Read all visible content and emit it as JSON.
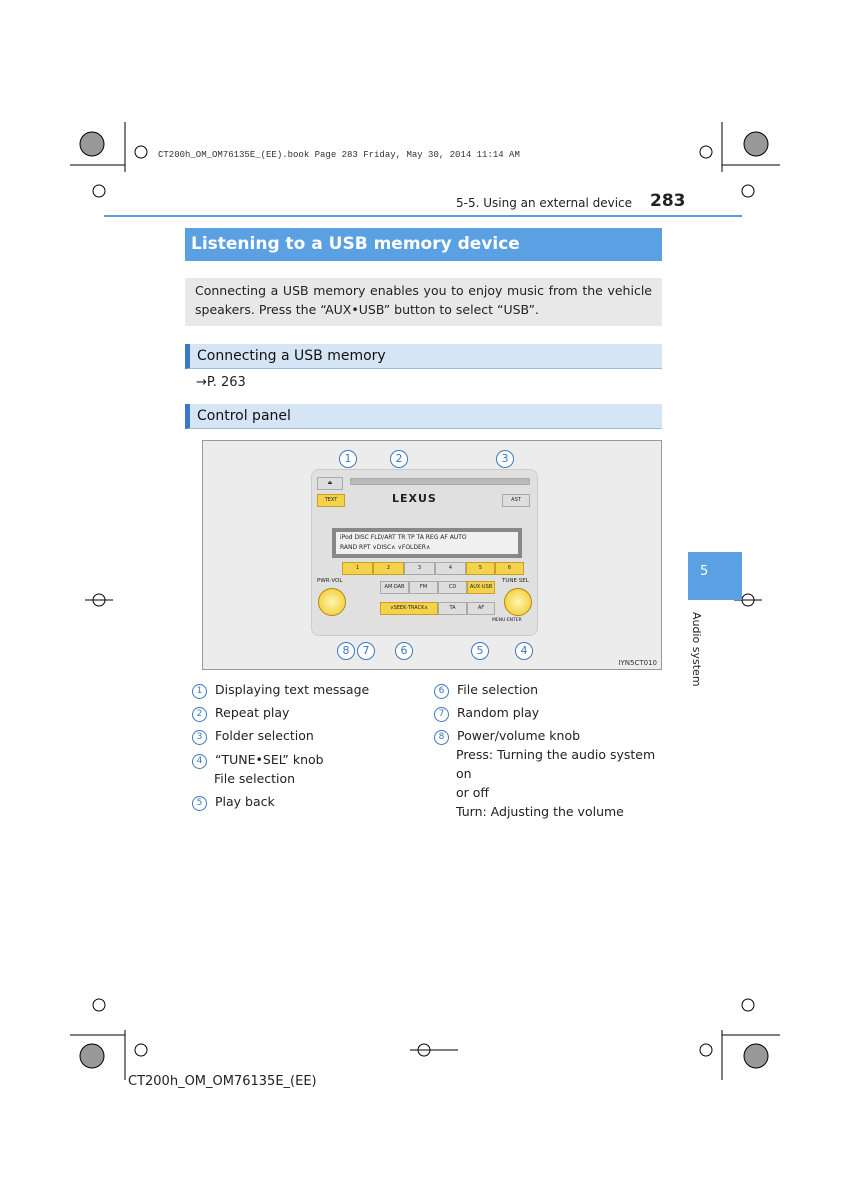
{
  "header": {
    "bookline": "CT200h_OM_OM76135E_(EE).book  Page 283  Friday, May 30, 2014  11:14 AM",
    "section": "5-5. Using an external device",
    "page_number": "283"
  },
  "title": "Listening to a USB memory device",
  "intro": "Connecting a USB memory enables you to enjoy music from the vehicle speakers. Press the “AUX•USB” button to select “USB”.",
  "sections": [
    {
      "title": "Connecting a USB memory",
      "ref": "→P. 263"
    },
    {
      "title": "Control panel"
    }
  ],
  "diagram": {
    "code": "IYN5CT010",
    "brand": "LEXUS",
    "buttons": {
      "text": "TEXT",
      "ast": "AST",
      "presets": [
        "1",
        "2",
        "3",
        "4",
        "5",
        "6"
      ],
      "sources": [
        "AM·DAB",
        "FM",
        "CD",
        "AUX·USB"
      ],
      "seek": "∨SEEK·TRACK∧",
      "ta": "TA",
      "af": "AF",
      "pwr": "PWR·VOL",
      "tune": "TUNE·SEL",
      "menu": "MENU·ENTER"
    },
    "lcd": {
      "top": "iPod DISC  FLD/ART  TR    TP TA REG AF AUTO",
      "bottom": "RAND  RPT   ∨DISC∧   ∨FOLDER∧"
    },
    "callouts": [
      "1",
      "2",
      "3",
      "4",
      "5",
      "6",
      "7",
      "8"
    ]
  },
  "legend": [
    {
      "n": "1",
      "text": "Displaying text message"
    },
    {
      "n": "2",
      "text": "Repeat play"
    },
    {
      "n": "3",
      "text": "Folder selection"
    },
    {
      "n": "4",
      "text": "“TUNE•SEL” knob",
      "sub": [
        "File selection"
      ]
    },
    {
      "n": "5",
      "text": "Play back"
    },
    {
      "n": "6",
      "text": "File selection"
    },
    {
      "n": "7",
      "text": "Random play"
    },
    {
      "n": "8",
      "text": "Power/volume knob",
      "sub": [
        "Press: Turning the audio system on",
        "or off",
        "Turn: Adjusting the volume"
      ]
    }
  ],
  "side_tab": {
    "number": "5",
    "label": "Audio system"
  },
  "footer": "CT200h_OM_OM76135E_(EE)",
  "colors": {
    "accent": "#5aa0e3",
    "subheader": "#d5e5f6",
    "intro_bg": "#e8e8e8",
    "highlight": "#f5d24b"
  }
}
